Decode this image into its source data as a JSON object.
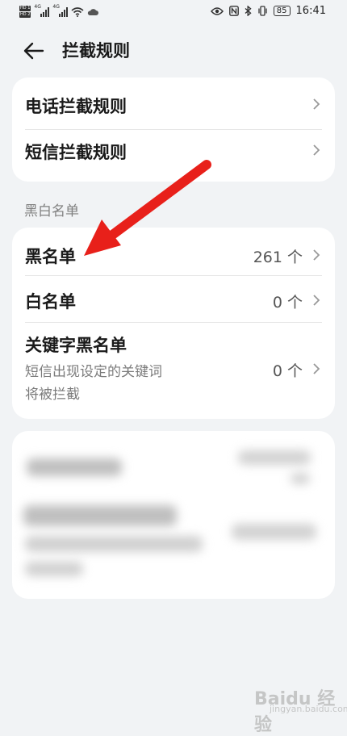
{
  "status_bar": {
    "sim_badges": [
      "HD 1",
      "HD 2"
    ],
    "network_type": "4G",
    "battery": "85",
    "time": "16:41"
  },
  "app_bar": {
    "title": "拦截规则"
  },
  "interception_rules": [
    {
      "label": "电话拦截规则"
    },
    {
      "label": "短信拦截规则"
    }
  ],
  "section_title": "黑白名单",
  "lists": {
    "blacklist": {
      "label": "黑名单",
      "count": "261 个"
    },
    "whitelist": {
      "label": "白名单",
      "count": "0 个"
    },
    "keyword_blacklist": {
      "label": "关键字黑名单",
      "description": "短信出现设定的关键词\n将被拦截",
      "count": "0 个"
    }
  },
  "annotation": {
    "color": "#e8201a"
  },
  "watermark": {
    "text": "Baidu 经验",
    "sub": "jingyan.baidu.com"
  }
}
